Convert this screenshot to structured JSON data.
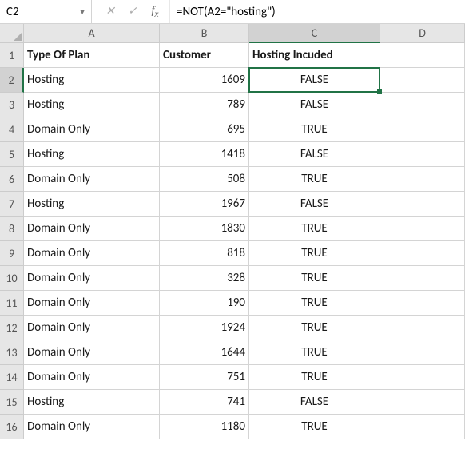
{
  "name_box": "C2",
  "formula": "=NOT(A2=\"hosting\")",
  "col_letters": [
    "A",
    "B",
    "C",
    "D"
  ],
  "selected_cell": {
    "row": 2,
    "col": "C"
  },
  "headers": {
    "A": "Type Of Plan",
    "B": "Customer",
    "C": "Hosting Incuded"
  },
  "chart_data": {
    "type": "table",
    "columns": [
      "Type Of Plan",
      "Customer",
      "Hosting Incuded"
    ],
    "rows": [
      {
        "plan": "Hosting",
        "customer": 1609,
        "included": "FALSE"
      },
      {
        "plan": "Hosting",
        "customer": 789,
        "included": "FALSE"
      },
      {
        "plan": "Domain Only",
        "customer": 695,
        "included": "TRUE"
      },
      {
        "plan": "Hosting",
        "customer": 1418,
        "included": "FALSE"
      },
      {
        "plan": "Domain Only",
        "customer": 508,
        "included": "TRUE"
      },
      {
        "plan": "Hosting",
        "customer": 1967,
        "included": "FALSE"
      },
      {
        "plan": "Domain Only",
        "customer": 1830,
        "included": "TRUE"
      },
      {
        "plan": "Domain Only",
        "customer": 818,
        "included": "TRUE"
      },
      {
        "plan": "Domain Only",
        "customer": 328,
        "included": "TRUE"
      },
      {
        "plan": "Domain Only",
        "customer": 190,
        "included": "TRUE"
      },
      {
        "plan": "Domain Only",
        "customer": 1924,
        "included": "TRUE"
      },
      {
        "plan": "Domain Only",
        "customer": 1644,
        "included": "TRUE"
      },
      {
        "plan": "Domain Only",
        "customer": 751,
        "included": "TRUE"
      },
      {
        "plan": "Hosting",
        "customer": 741,
        "included": "FALSE"
      },
      {
        "plan": "Domain Only",
        "customer": 1180,
        "included": "TRUE"
      }
    ]
  }
}
